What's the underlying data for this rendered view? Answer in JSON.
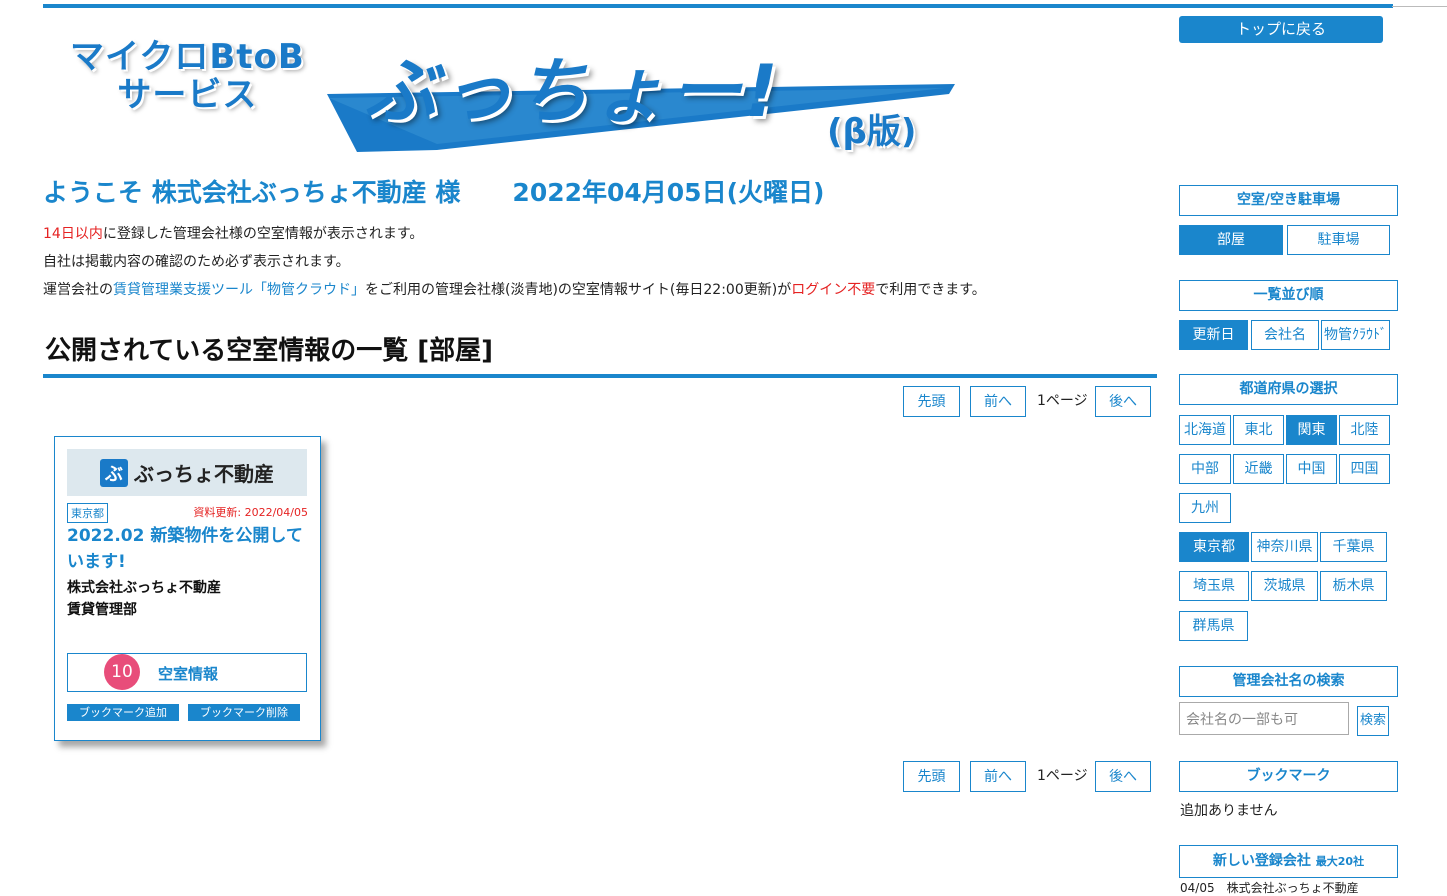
{
  "logo": {
    "sub_line1": "マイクロBtoB",
    "sub_line2": "サービス",
    "main": "ぶっちょー!",
    "beta": "(β版)"
  },
  "header": {
    "welcome": "ようこそ 株式会社ぶっちょ不動産 様",
    "date": "2022年04月05日(火曜日)"
  },
  "notices": {
    "line1_red": "14日以内",
    "line1_rest": "に登録した管理会社様の空室情報が表示されます。",
    "line2": "自社は掲載内容の確認のため必ず表示されます。",
    "line3_a": "運営会社の",
    "line3_link": "賃貸管理業支援ツール「物管クラウド」",
    "line3_b": "をご利用の管理会社様(淡青地)の空室情報サイト(毎日22:00更新)が",
    "line3_red": "ログイン不要",
    "line3_c": "で利用できます。"
  },
  "main": {
    "title": "公開されている空室情報の一覧 [部屋]",
    "pager": {
      "first": "先頭",
      "prev": "前へ",
      "page": "1ページ",
      "next": "後へ"
    }
  },
  "card": {
    "logo_mark": "ぶ",
    "logo_name": "ぶっちょ不動産",
    "pref": "東京都",
    "updated": "資料更新: 2022/04/05",
    "title": "2022.02 新築物件を公開しています!",
    "company": "株式会社ぶっちょ不動産",
    "dept": "賃貸管理部",
    "vacancy_count": "10",
    "vacancy_label": "空室情報",
    "bookmark_add": "ブックマーク追加",
    "bookmark_remove": "ブックマーク削除"
  },
  "sidebar": {
    "top_button": "トップに戻る",
    "type_header": "空室/空き駐車場",
    "type_room": "部屋",
    "type_parking": "駐車場",
    "order_header": "一覧並び順",
    "order_updated": "更新日",
    "order_company": "会社名",
    "order_cloud": "物管ｸﾗｳﾄﾞ",
    "region_header": "都道府県の選択",
    "regions": [
      "北海道",
      "東北",
      "関東",
      "北陸",
      "中部",
      "近畿",
      "中国",
      "四国",
      "九州"
    ],
    "prefs": [
      "東京都",
      "神奈川県",
      "千葉県",
      "埼玉県",
      "茨城県",
      "栃木県",
      "群馬県"
    ],
    "search_header": "管理会社名の検索",
    "search_placeholder": "会社名の一部も可",
    "search_button": "検索",
    "bookmark_header": "ブックマーク",
    "bookmark_empty": "追加ありません",
    "new_header": "新しい登録会社",
    "new_header_note": "最大20社",
    "new_first": "04/05　株式会社ぶっちょ不動産"
  },
  "colors": {
    "accent": "#1a86cc",
    "alert": "#e52222",
    "badge": "#e84d7a"
  }
}
